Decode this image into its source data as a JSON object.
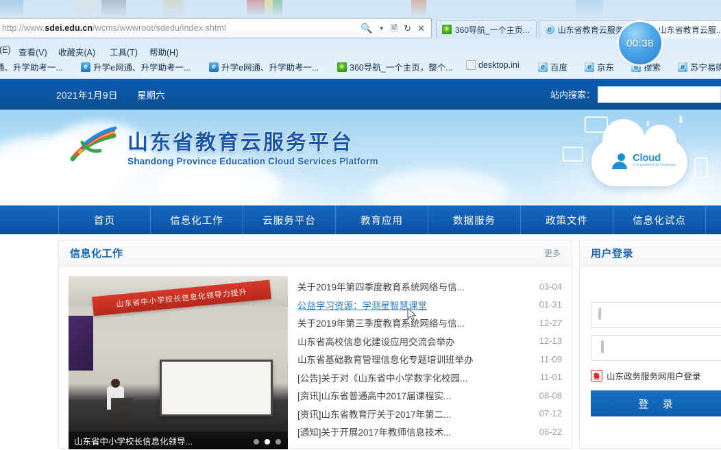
{
  "browser": {
    "address": {
      "prefix": "http://www.",
      "domain": "sdei.edu.cn",
      "path": "/wcms/wwwroot/sdedu/index.shtml"
    },
    "address_icons": [
      "search-icon",
      "caret-down-icon",
      "reading-view-icon",
      "refresh-icon",
      "stop-icon"
    ],
    "tabs": [
      {
        "label": "360导航_一个主页...",
        "icon": "360-icon",
        "active": false
      },
      {
        "label": "山东省教育云服务...",
        "icon": "ie-icon",
        "active": false
      },
      {
        "label": "山东省教育云服...",
        "icon": "generic-page-icon",
        "active": true
      }
    ],
    "menu": [
      "(E)",
      "查看(V)",
      "收藏夹(A)",
      "工具(T)",
      "帮助(H)"
    ],
    "bookmarks": [
      {
        "label": "通、升学助考一...",
        "icon": "sxe-icon"
      },
      {
        "label": "升学e网通、升学助考一...",
        "icon": "sxe-icon"
      },
      {
        "label": "升学e网通、升学助考一...",
        "icon": "sxe-icon"
      },
      {
        "label": "360导航_一个主页，整个...",
        "icon": "360-icon"
      },
      {
        "label": "desktop.ini",
        "icon": "doc-icon"
      },
      {
        "label": "百度",
        "icon": "ie-icon"
      },
      {
        "label": "京东",
        "icon": "ie-icon"
      },
      {
        "label": "搜索",
        "icon": "ie-icon"
      },
      {
        "label": "苏宁易购",
        "icon": "ie-icon"
      }
    ],
    "timer": "00:38"
  },
  "site": {
    "topbar": {
      "date": "2021年1月9日",
      "weekday": "星期六",
      "search_label": "站内搜索：",
      "search_value": "",
      "search_placeholder": ""
    },
    "logo": {
      "title_cn": "山东省教育云服务平台",
      "title_en": "Shandong Province Education Cloud Services Platform"
    },
    "cloud_art": {
      "word": "Cloud",
      "sub": "It is powerful for business"
    },
    "nav": [
      "首页",
      "信息化工作",
      "云服务平台",
      "教育应用",
      "数据服务",
      "政策文件",
      "信息化试点"
    ],
    "panel": {
      "title": "信息化工作",
      "more": "更多",
      "carousel": {
        "caption": "山东省中小学校长信息化领导...",
        "banner_text": "山东省中小学校长信息化领导力提升",
        "dots": 3,
        "active_dot": 1
      },
      "news": [
        {
          "title": "关于2019年第四季度教育系统网络与信...",
          "date": "03-04",
          "hovered": false
        },
        {
          "title": "公益学习资源：学测星智慧课堂",
          "date": "01-31",
          "hovered": true
        },
        {
          "title": "关于2019年第三季度教育系统网络与信...",
          "date": "12-27",
          "hovered": false
        },
        {
          "title": "山东省高校信息化建设应用交流会举办",
          "date": "12-13",
          "hovered": false
        },
        {
          "title": "山东省基础教育管理信息化专题培训班举办",
          "date": "11-09",
          "hovered": false
        },
        {
          "title": "[公告]关于对《山东省中小学数字化校园...",
          "date": "11-01",
          "hovered": false
        },
        {
          "title": "[资讯]山东省普通高中2017届课程实...",
          "date": "08-08",
          "hovered": false
        },
        {
          "title": "[资讯]山东省教育厅关于2017年第二...",
          "date": "07-12",
          "hovered": false
        },
        {
          "title": "[通知]关于开展2017年教师信息技术...",
          "date": "06-22",
          "hovered": false
        }
      ]
    },
    "login": {
      "title": "用户登录",
      "username_value": "",
      "username_placeholder": "",
      "password_value": "",
      "password_placeholder": "",
      "gov_link": "山东政务服务网用户登录",
      "submit": "登 录"
    }
  },
  "colors": {
    "brand_blue": "#0a55a4",
    "nav_blue": "#0f5cb2",
    "accent_link": "#2f7fc4",
    "panel_title": "#1a63ad",
    "logo_blue": "#1556a8"
  }
}
